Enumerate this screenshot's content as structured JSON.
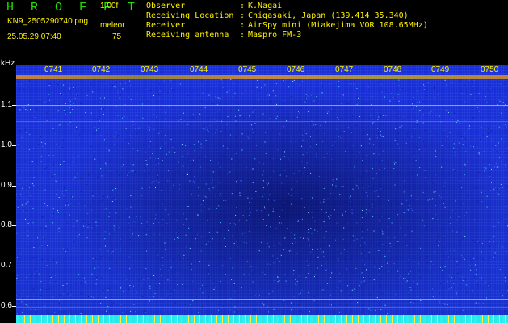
{
  "header": {
    "title": "H R O F F T",
    "version": "1.00f",
    "filename": "KN9_2505290740.png",
    "datetime": "25.05.29 07:40",
    "mode_label": "meleor",
    "mode_value": "75",
    "meta": [
      {
        "key": "Observer",
        "sep": ":",
        "value": "K.Nagai"
      },
      {
        "key": "Receiving Location",
        "sep": ":",
        "value": "Chigasaki, Japan (139.414 35.340)"
      },
      {
        "key": "Receiver",
        "sep": ":",
        "value": "AirSpy mini (Miakejima VOR 108.65MHz)"
      },
      {
        "key": "Receiving antenna",
        "sep": ":",
        "value": "Maspro FM-3"
      }
    ]
  },
  "axes": {
    "y_unit": "kHz",
    "y_ticks": [
      "1.1",
      "1.0",
      "0.9",
      "0.8",
      "0.7",
      "0.6"
    ],
    "x_ticks": [
      "0741",
      "0742",
      "0743",
      "0744",
      "0745",
      "0746",
      "0747",
      "0748",
      "0749",
      "0750"
    ]
  },
  "colors": {
    "accent": "#fff200",
    "title": "#22e000",
    "background": "#1a2ed8"
  }
}
